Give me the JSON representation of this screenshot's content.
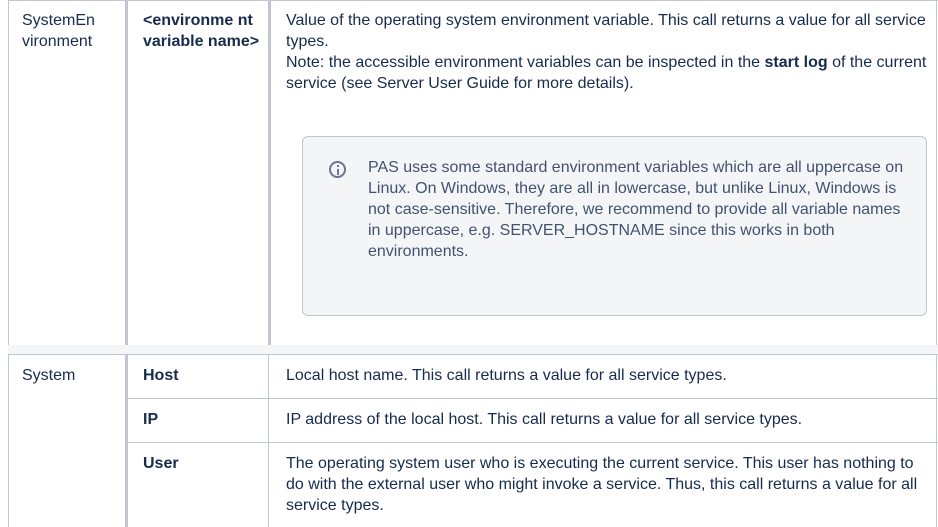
{
  "row1": {
    "category": "SystemEn vironment",
    "key": "<environme nt variable name>",
    "desc_line1": "Value of the operating system environment variable. This call returns a value for all service types.",
    "desc_note_prefix": "Note: the accessible environment variables can be inspected in the ",
    "desc_note_bold": "start log",
    "desc_note_suffix": " of the current service (see Server User Guide for more details).",
    "info_text": "PAS uses some standard environment variables which are all uppercase on Linux. On Windows, they are all in lowercase, but unlike Linux, Windows is not case-sensitive. Therefore, we recommend to provide all variable names in uppercase, e.g. SERVER_HOSTNAME since this works in both environments."
  },
  "row2": {
    "category": "System",
    "items": [
      {
        "key": "Host",
        "desc": "Local host name. This call returns a value for all service types."
      },
      {
        "key": "IP",
        "desc": "IP address of the local host. This call returns a value for all service types."
      },
      {
        "key": "User",
        "desc": "The operating system user who is executing the current service. This user has nothing to do with the external user who might invoke a service. Thus, this call returns a value for all service types."
      }
    ]
  },
  "colors": {
    "border": "#c1c7d0",
    "panel": "#f4f5f7",
    "text": "#172b4d",
    "icon": "#6b778c"
  }
}
